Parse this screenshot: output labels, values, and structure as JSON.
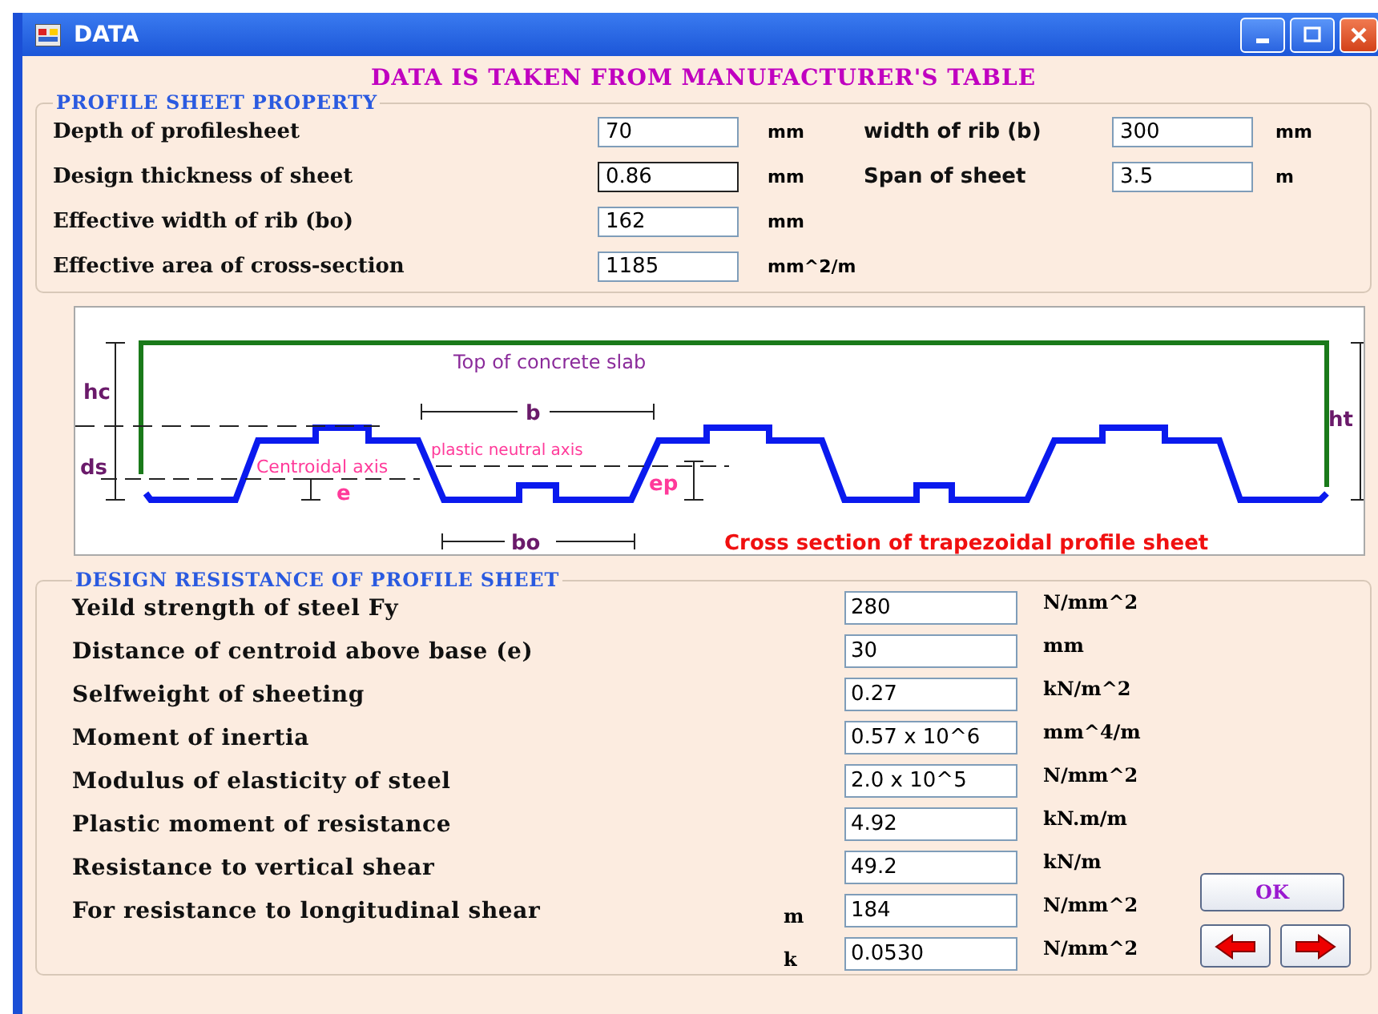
{
  "window": {
    "title": "DATA"
  },
  "heading": "DATA IS TAKEN FROM MANUFACTURER'S TABLE",
  "profile": {
    "title": "PROFILE SHEET PROPERTY",
    "fields": [
      {
        "label": "Depth of  profilesheet",
        "value": "70",
        "unit": "mm",
        "focused": false
      },
      {
        "label": "Design thickness of sheet",
        "value": "0.86",
        "unit": "mm",
        "focused": true
      },
      {
        "label": "Effective width of rib (bo)",
        "value": "162",
        "unit": "mm",
        "focused": false
      },
      {
        "label": "Effective area of cross-section",
        "value": "1185",
        "unit": "mm^2/m",
        "focused": false
      }
    ],
    "side_fields": [
      {
        "label": "width of rib (b)",
        "value": "300",
        "unit": "mm",
        "focused": false
      },
      {
        "label": "Span  of sheet",
        "value": "3.5",
        "unit": "m",
        "focused": false
      }
    ]
  },
  "diagram": {
    "slab": "Top of concrete slab",
    "hc": "hc",
    "ds": "ds",
    "b": "b",
    "ht": "ht",
    "centroidal": "Centroidal axis",
    "plastic": "plastic neutral axis",
    "e": "e",
    "ep": "ep",
    "bo": "bo",
    "caption": "Cross section of trapezoidal profile sheet"
  },
  "resistance": {
    "title": "DESIGN RESISTANCE OF PROFILE SHEET",
    "fields": [
      {
        "label": "Yeild strength of steel Fy",
        "value": "280",
        "unit": "N/mm^2"
      },
      {
        "label": "Distance of centroid above base (e)",
        "value": "30",
        "unit": "mm"
      },
      {
        "label": "Selfweight of sheeting",
        "value": "0.27",
        "unit": "kN/m^2"
      },
      {
        "label": "Moment of inertia",
        "value": "0.57 x 10^6",
        "unit": "mm^4/m"
      },
      {
        "label": "Modulus of elasticity of steel",
        "value": "2.0 x 10^5",
        "unit": "N/mm^2"
      },
      {
        "label": "Plastic moment of resistance",
        "value": "4.92",
        "unit": "kN.m/m"
      },
      {
        "label": "Resistance to vertical shear",
        "value": "49.2",
        "unit": "kN/m"
      }
    ],
    "shear_label": "For resistance to longitudinal shear",
    "shear_fields": [
      {
        "symbol": "m",
        "value": "184",
        "unit": "N/mm^2"
      },
      {
        "symbol": "k",
        "value": "0.0530",
        "unit": "N/mm^2"
      }
    ]
  },
  "ok_button": "OK"
}
